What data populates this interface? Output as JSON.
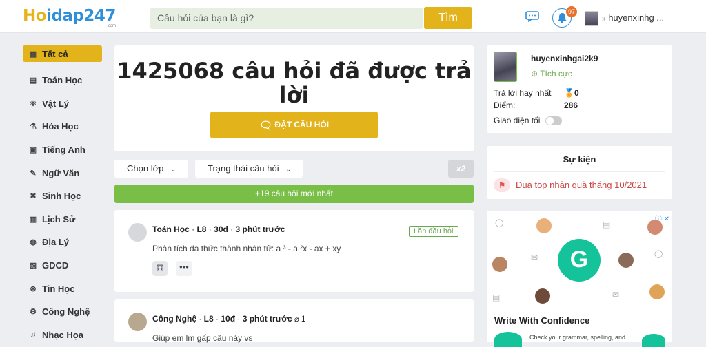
{
  "header": {
    "logo_part1": "Ho",
    "logo_part2": "idap247",
    "logo_sub": ".com",
    "search_placeholder": "Câu hỏi của bạn là gì?",
    "search_button": "Tìm",
    "notification_count": "97",
    "username": "huyenxinhg ..."
  },
  "sidebar": {
    "items": [
      {
        "label": "Tất cả",
        "icon": "grid-icon"
      },
      {
        "label": "Toán Học",
        "icon": "math-icon"
      },
      {
        "label": "Vật Lý",
        "icon": "atom-icon"
      },
      {
        "label": "Hóa Học",
        "icon": "flask-icon"
      },
      {
        "label": "Tiếng Anh",
        "icon": "language-icon"
      },
      {
        "label": "Ngữ Văn",
        "icon": "pen-icon"
      },
      {
        "label": "Sinh Học",
        "icon": "dna-icon"
      },
      {
        "label": "Lịch Sử",
        "icon": "scroll-icon"
      },
      {
        "label": "Địa Lý",
        "icon": "globe-icon"
      },
      {
        "label": "GDCD",
        "icon": "book-icon"
      },
      {
        "label": "Tin Học",
        "icon": "chip-icon"
      },
      {
        "label": "Công Nghệ",
        "icon": "gear-icon"
      },
      {
        "label": "Nhạc Họa",
        "icon": "music-icon"
      }
    ]
  },
  "hero": {
    "title": "1425068 câu hỏi đã được trả lời",
    "ask_button": "ĐẶT CÂU HỎI"
  },
  "filters": {
    "class_select": "Chọn lớp",
    "status_select": "Trạng thái câu hỏi",
    "x2_badge": "x2"
  },
  "new_questions": "+19 câu hỏi mới nhất",
  "questions": [
    {
      "subject": "Toán Học",
      "grade": "L8",
      "points": "30đ",
      "time": "3 phút trước",
      "tag": "Lần đầu hỏi",
      "text": "Phân tích đa thức thành nhân tử: a ³ - a ²x - ax + xy"
    },
    {
      "subject": "Công Nghệ",
      "grade": "L8",
      "points": "10đ",
      "time": "3 phút trước",
      "attachments": "1",
      "text": "Giúp em lm gấp câu này vs"
    }
  ],
  "profile": {
    "name": "huyenxinhgai2k9",
    "rank": "Tích cực",
    "best_answer_label": "Trả lời hay nhất",
    "best_answer_value": "0",
    "points_label": "Điểm:",
    "points_value": "286",
    "dark_mode_label": "Giao diện tối"
  },
  "events": {
    "title": "Sự kiện",
    "item": "Đua top nhận quà tháng 10/2021"
  },
  "ad": {
    "logo_letter": "G",
    "headline": "Write With Confidence",
    "sub": "Check your grammar, spelling, and"
  },
  "colors": {
    "accent": "#e3b31c",
    "brand_blue": "#2f8fd8",
    "green": "#78be47",
    "grammarly": "#15c39a"
  }
}
